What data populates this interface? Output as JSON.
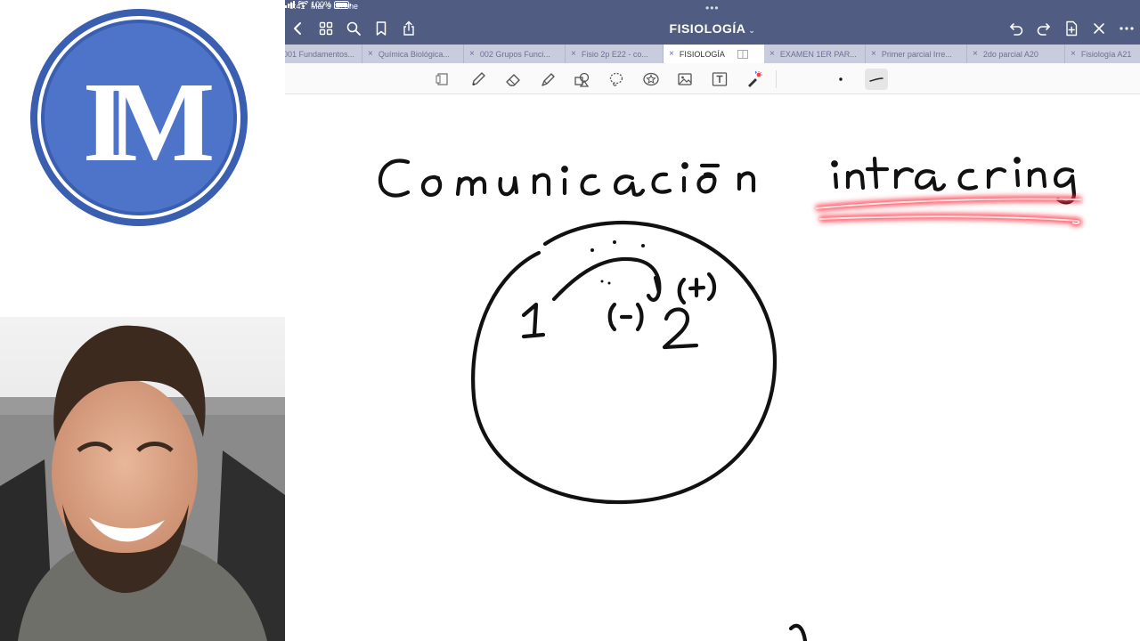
{
  "status": {
    "time": "9:41",
    "date": "Mar 9 de ene",
    "battery": "100%"
  },
  "logo": {
    "text": "IM",
    "colors": {
      "outer": "#3a5fb0",
      "inner": "#4a72c8",
      "ring": "#ffffff"
    }
  },
  "document": {
    "title": "FISIOLOGÍA",
    "title_chevron": "⌄"
  },
  "toolbar": {
    "left": [
      "back-icon",
      "grid-icon",
      "search-icon",
      "bookmark-icon",
      "share-icon"
    ],
    "right": [
      "undo-icon",
      "redo-icon",
      "add-page-icon",
      "close-icon",
      "more-icon"
    ]
  },
  "tabs": [
    {
      "label": "001 Fundamentos..."
    },
    {
      "label": "Química Biológica..."
    },
    {
      "label": "002 Grupos Funci..."
    },
    {
      "label": "Fisio 2p E22 - co..."
    },
    {
      "label": "FISIOLOGÍA",
      "active": true
    },
    {
      "label": "EXAMEN 1ER PAR..."
    },
    {
      "label": "Primer parcial Irre..."
    },
    {
      "label": "2do parcial A20"
    },
    {
      "label": "Fisiología A21"
    }
  ],
  "tools": [
    "page-layout-icon",
    "pen-icon",
    "eraser-icon",
    "highlighter-icon",
    "shapes-icon",
    "lasso-icon",
    "sticker-icon",
    "image-icon",
    "text-icon",
    "laser-icon"
  ],
  "colors": {
    "topbar": "#505c81",
    "tabbar": "#c9ccdc",
    "ink": "#111111",
    "highlight": "#ff3b4a"
  }
}
